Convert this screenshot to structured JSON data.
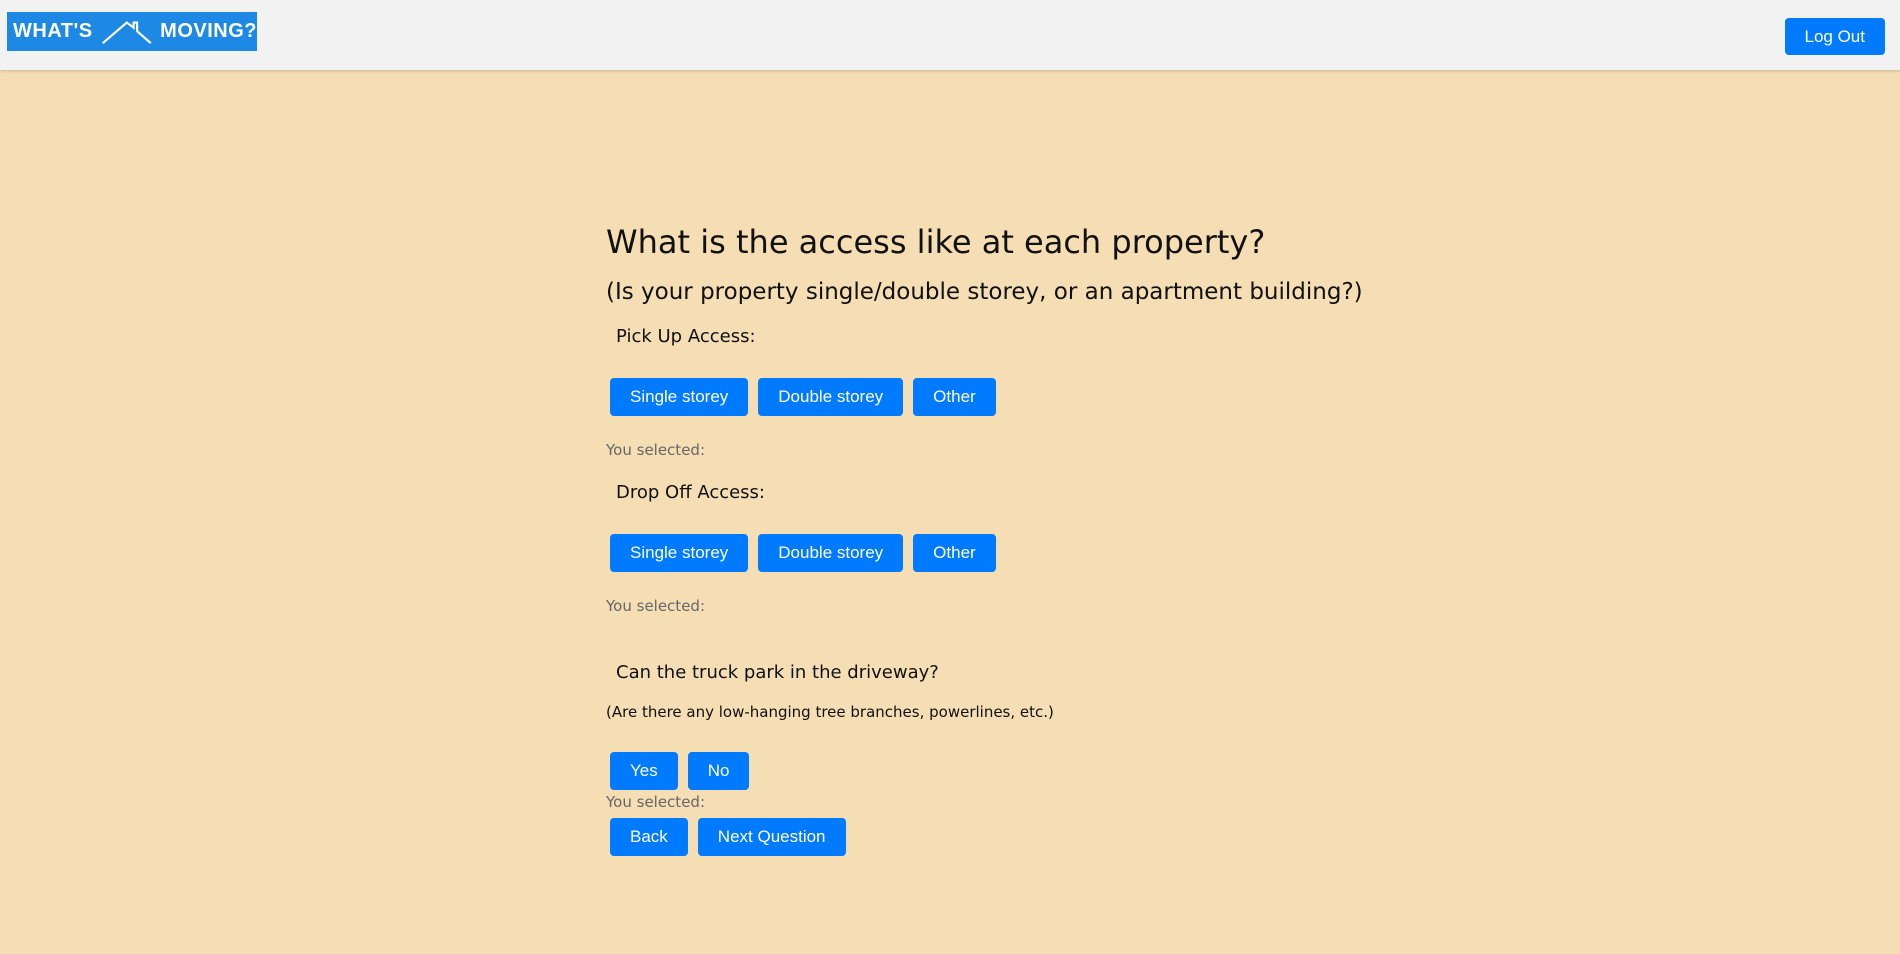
{
  "header": {
    "logo_left": "WHAT'S",
    "logo_right": "MOVING?",
    "logout_label": "Log Out"
  },
  "main": {
    "title": "What is the access like at each property?",
    "subtitle": "(Is your property single/double storey, or an apartment building?)",
    "pickup": {
      "label": "Pick Up Access:",
      "options": [
        "Single storey",
        "Double storey",
        "Other"
      ],
      "selected_text": "You selected:"
    },
    "dropoff": {
      "label": "Drop Off Access:",
      "options": [
        "Single storey",
        "Double storey",
        "Other"
      ],
      "selected_text": "You selected:"
    },
    "driveway": {
      "question": "Can the truck park in the driveway?",
      "note": "(Are there any low-hanging tree branches, powerlines, etc.)",
      "options": [
        "Yes",
        "No"
      ],
      "selected_text": "You selected:"
    },
    "nav": {
      "back_label": "Back",
      "next_label": "Next Question"
    }
  },
  "colors": {
    "background": "#f5deb3",
    "navbar": "#f2f2f2",
    "button": "#007bff",
    "logo": "#1e88e5"
  }
}
